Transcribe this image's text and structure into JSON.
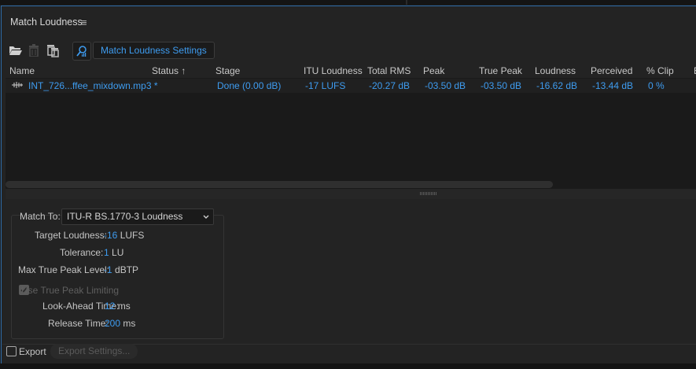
{
  "panel": {
    "title": "Match Loudness",
    "menu_icon": "≡"
  },
  "toolbar": {
    "open_icon": "folder-open-icon",
    "trash_icon": "trash-icon",
    "trash_all_icon": "trash-all-icon",
    "analyze_icon": "loudness-scan-icon",
    "settings_label": "Match Loudness Settings"
  },
  "table": {
    "columns": [
      "Name",
      "Status",
      "Stage",
      "ITU Loudness",
      "Total RMS",
      "Peak",
      "True Peak",
      "Loudness",
      "Perceived",
      "% Clip",
      "B"
    ],
    "sort_arrow": "↑",
    "rows": [
      {
        "icon": "waveform-icon",
        "name": "INT_726...ffee_mixdown.mp3 *",
        "status": "",
        "stage": "Done (0.00 dB)",
        "itu": "-17 LUFS",
        "rms": "-20.27 dB",
        "peak": "-03.50 dB",
        "true_peak": "-03.50 dB",
        "loudness": "-16.62 dB",
        "perceived": "-13.44 dB",
        "clip": "0 %"
      }
    ]
  },
  "settings": {
    "match_to_label": "Match To:",
    "match_to_value": "ITU-R BS.1770-3 Loudness",
    "target_label": "Target Loudness:",
    "target_value": "-16",
    "target_unit": "LUFS",
    "tolerance_label": "Tolerance:",
    "tolerance_value": "1",
    "tolerance_unit": "LU",
    "max_peak_label": "Max True Peak Level:",
    "max_peak_value": "-1",
    "max_peak_unit": "dBTP",
    "use_limiting_label": "Use True Peak Limiting",
    "use_limiting_checked": true,
    "lookahead_label": "Look-Ahead Time:",
    "lookahead_value": "12",
    "lookahead_unit": "ms",
    "release_label": "Release Time:",
    "release_value": "200",
    "release_unit": "ms"
  },
  "export": {
    "checkbox_label": "Export",
    "checked": false,
    "settings_button": "Export Settings..."
  },
  "colors": {
    "accent": "#3e9cf0",
    "panel_border": "#2e6ba8",
    "background": "#232323"
  }
}
